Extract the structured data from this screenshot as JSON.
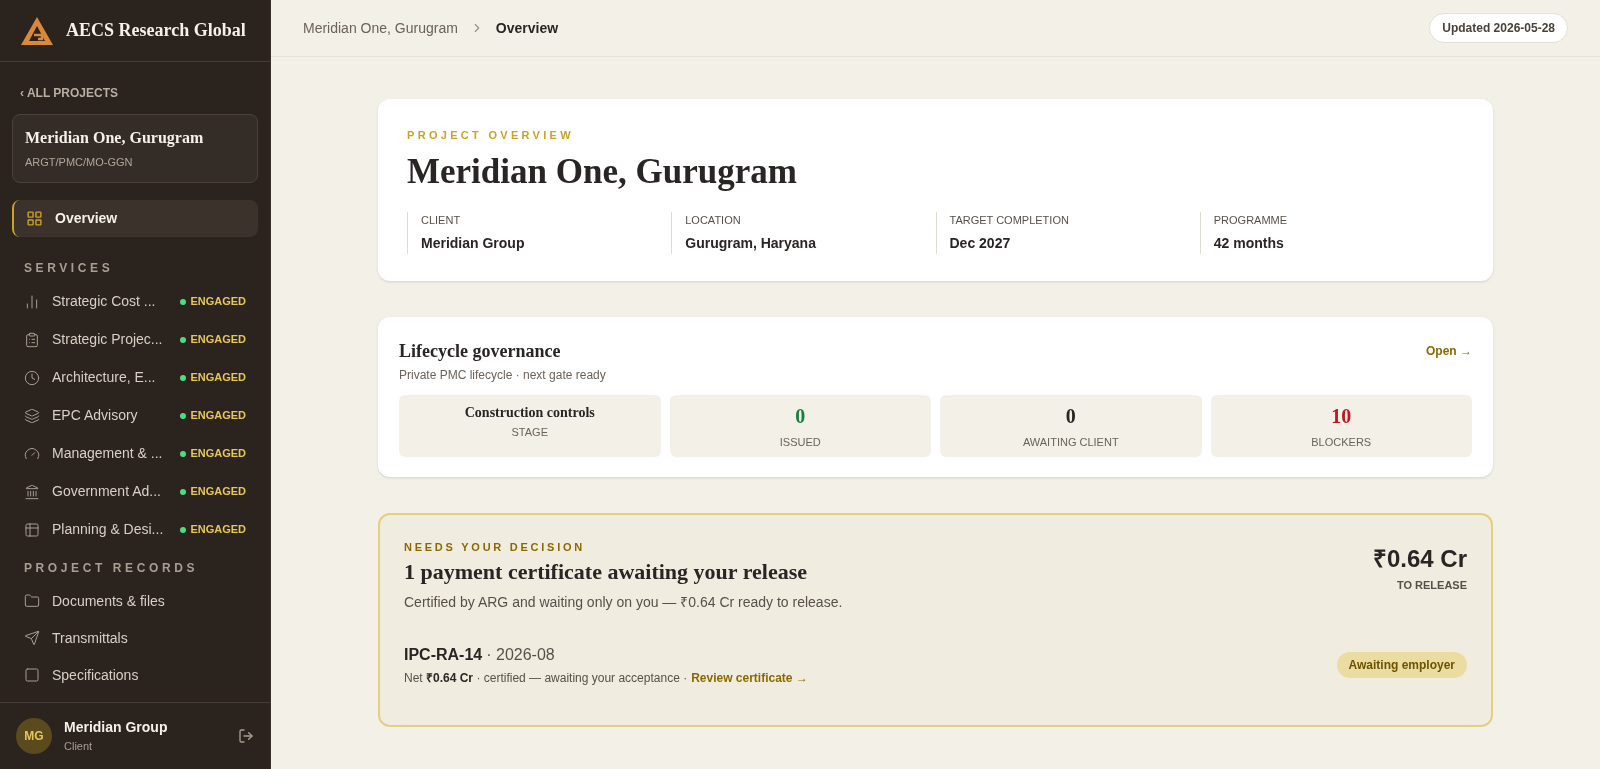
{
  "brand": {
    "name": "AECS Research Global"
  },
  "sidebar": {
    "back_link": "‹ ALL PROJECTS",
    "project": {
      "name": "Meridian One, Gurugram",
      "code": "ARGT/PMC/MO-GGN"
    },
    "overview": {
      "label": "Overview",
      "selected": true
    },
    "services_heading": "SERVICES",
    "services": [
      {
        "label": "Strategic Cost ...",
        "status": "ENGAGED",
        "color": "#4ade80"
      },
      {
        "label": "Strategic Projec...",
        "status": "ENGAGED",
        "color": "#4ade80"
      },
      {
        "label": "Architecture, E...",
        "status": "ENGAGED",
        "color": "#4ade80"
      },
      {
        "label": "EPC Advisory",
        "status": "ENGAGED",
        "color": "#4ade80"
      },
      {
        "label": "Management & ...",
        "status": "ENGAGED",
        "color": "#4ade80"
      },
      {
        "label": "Government Ad...",
        "status": "ENGAGED",
        "color": "#4ade80"
      },
      {
        "label": "Planning & Desi...",
        "status": "ENGAGED",
        "color": "#4ade80"
      }
    ],
    "records_heading": "PROJECT RECORDS",
    "records": [
      "Documents & files",
      "Transmittals",
      "Specifications"
    ],
    "user": {
      "initials": "MG",
      "name": "Meridian Group",
      "role": "Client"
    }
  },
  "breadcrumb": [
    {
      "label": "Meridian One, Gurugram",
      "selected": false
    },
    {
      "label": "Overview",
      "selected": true
    }
  ],
  "updated": "Updated 2026-05-28",
  "overview_card": {
    "eyebrow": "PROJECT OVERVIEW",
    "title": "Meridian One, Gurugram",
    "facts": [
      {
        "label": "CLIENT",
        "value": "Meridian Group"
      },
      {
        "label": "LOCATION",
        "value": "Gurugram, Haryana"
      },
      {
        "label": "TARGET COMPLETION",
        "value": "Dec 2027"
      },
      {
        "label": "PROGRAMME",
        "value": "42 months"
      }
    ]
  },
  "lifecycle": {
    "title": "Lifecycle governance",
    "subtitle": "Private PMC lifecycle · next gate ready",
    "link": "Open →",
    "stats": [
      {
        "kind": "stage",
        "value": "Construction controls",
        "label": "STAGE"
      },
      {
        "kind": "count",
        "value": "0",
        "label": "ISSUED",
        "color": "#15803d"
      },
      {
        "kind": "count",
        "value": "0",
        "label": "AWAITING CLIENT",
        "color": "#292524"
      },
      {
        "kind": "count",
        "value": "10",
        "label": "BLOCKERS",
        "color": "#b91c1c"
      }
    ]
  },
  "decision": {
    "eyebrow": "NEEDS YOUR DECISION",
    "title": "1 payment certificate awaiting your release",
    "text": "Certified by ARG and waiting only on you — ₹0.64 Cr ready to release.",
    "amount": "₹0.64 Cr",
    "amount_label": "TO RELEASE",
    "items": [
      {
        "id": "IPC-RA-14",
        "period": "· 2026-08",
        "detail": "Net **₹0.64 Cr** · certified — awaiting your acceptance ·",
        "link": "Review certificate →",
        "badge": "Awaiting employer"
      }
    ]
  }
}
